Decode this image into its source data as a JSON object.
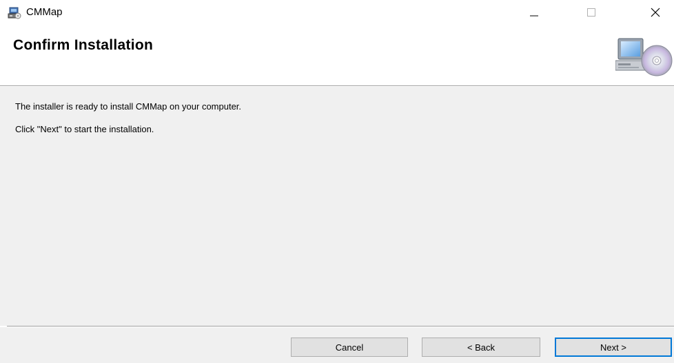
{
  "window": {
    "title": "CMMap",
    "minimize_icon": "minimize-icon",
    "maximize_icon": "maximize-icon",
    "close_icon": "close-icon"
  },
  "header": {
    "title": "Confirm Installation",
    "icon": "computer-cd-icon"
  },
  "body": {
    "message_line1": "The installer is ready to install CMMap on your computer.",
    "message_line2": "Click \"Next\" to start the installation."
  },
  "footer": {
    "cancel_label": "Cancel",
    "back_label": "< Back",
    "next_label": "Next >"
  },
  "colors": {
    "content_background": "#f0f0f0",
    "default_button_border": "#0078d7"
  }
}
